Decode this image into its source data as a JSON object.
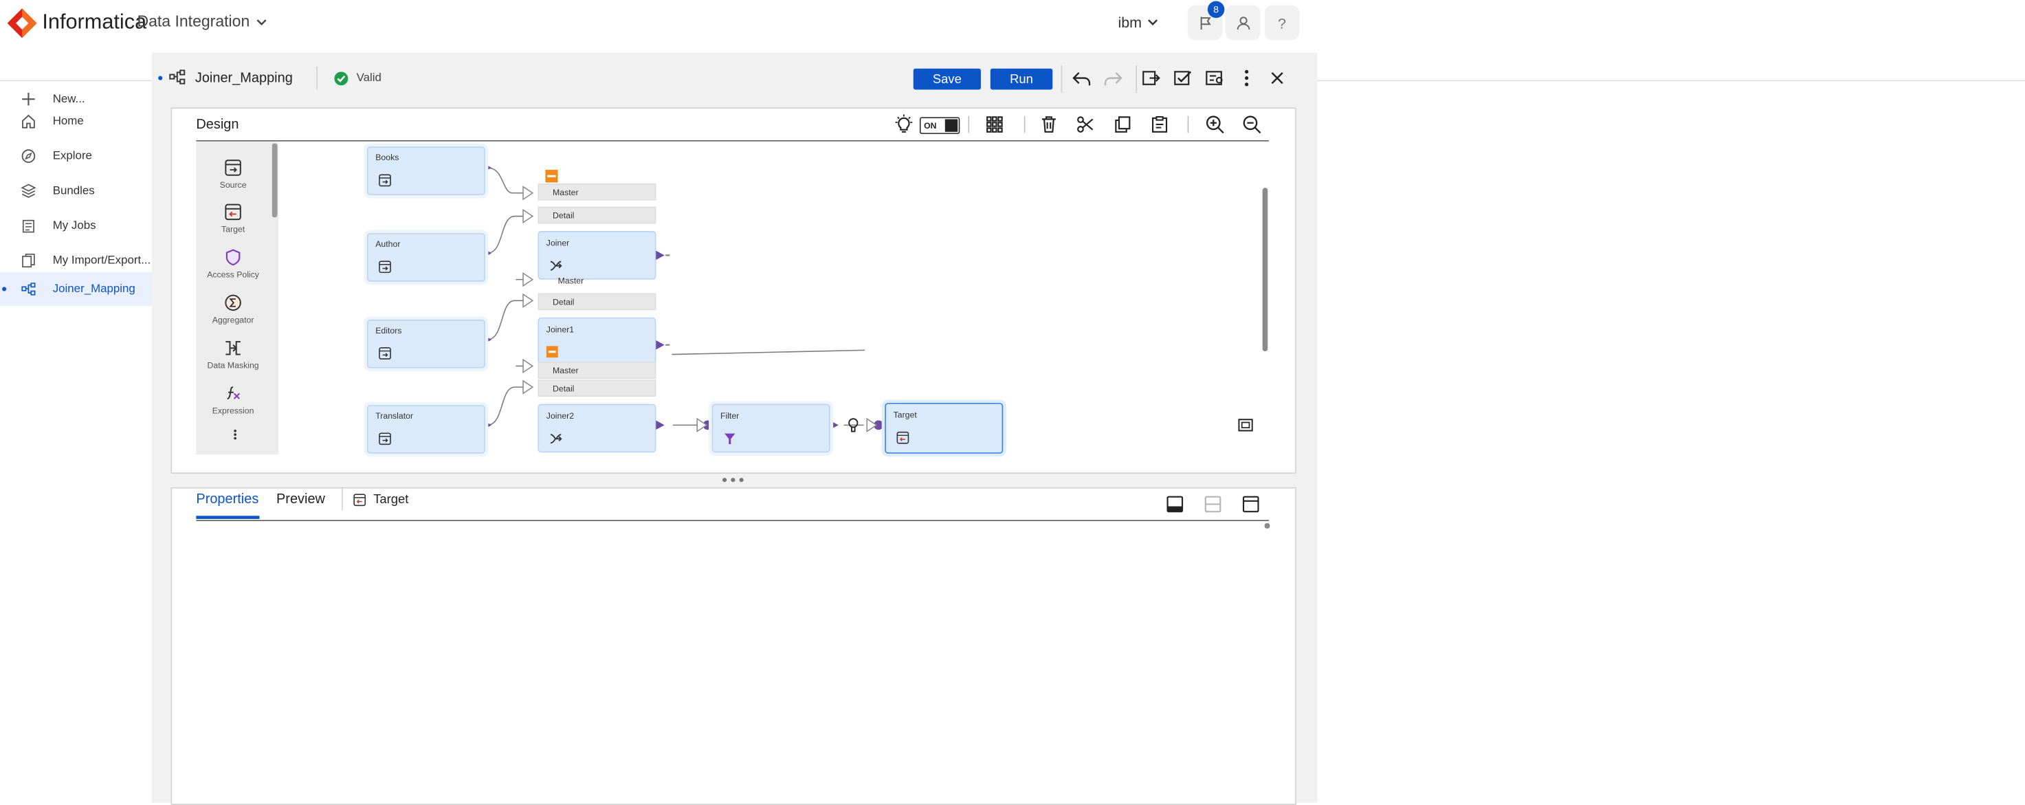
{
  "header": {
    "brand": "Informatica",
    "product": "Data Integration",
    "org": "ibm",
    "notification_count": "8",
    "colors": {
      "brand_orange": "#f26b21",
      "brand_red": "#e2231a",
      "accent": "#0c55c8"
    }
  },
  "sidebar": {
    "items": [
      {
        "label": "New...",
        "icon": "plus-icon"
      },
      {
        "label": "Home",
        "icon": "home-icon"
      },
      {
        "label": "Explore",
        "icon": "compass-icon"
      },
      {
        "label": "Bundles",
        "icon": "bundles-icon"
      },
      {
        "label": "My Jobs",
        "icon": "jobs-icon"
      },
      {
        "label": "My Import/Export...",
        "icon": "import-export-icon"
      },
      {
        "label": "Joiner_Mapping",
        "icon": "mapping-icon"
      }
    ]
  },
  "mapping": {
    "title": "Joiner_Mapping",
    "status": "Valid",
    "save_label": "Save",
    "run_label": "Run"
  },
  "design": {
    "title": "Design",
    "toggle_label": "ON"
  },
  "palette": {
    "items": [
      {
        "label": "Source",
        "icon": "source-icon"
      },
      {
        "label": "Target",
        "icon": "target-icon"
      },
      {
        "label": "Access Policy",
        "icon": "shield-icon"
      },
      {
        "label": "Aggregator",
        "icon": "sigma-icon"
      },
      {
        "label": "Data Masking",
        "icon": "data-masking-icon"
      },
      {
        "label": "Expression",
        "icon": "fx-icon"
      }
    ]
  },
  "canvas": {
    "nodes": {
      "books": "Books",
      "author": "Author",
      "editors": "Editors",
      "translator": "Translator",
      "joiner": "Joiner",
      "joiner1": "Joiner1",
      "joiner2": "Joiner2",
      "filter": "Filter",
      "target": "Target"
    },
    "ports": {
      "master": "Master",
      "detail": "Detail",
      "master_hidden": "Master"
    }
  },
  "properties": {
    "tabs": [
      "Properties",
      "Preview"
    ],
    "selected_object": "Target"
  }
}
